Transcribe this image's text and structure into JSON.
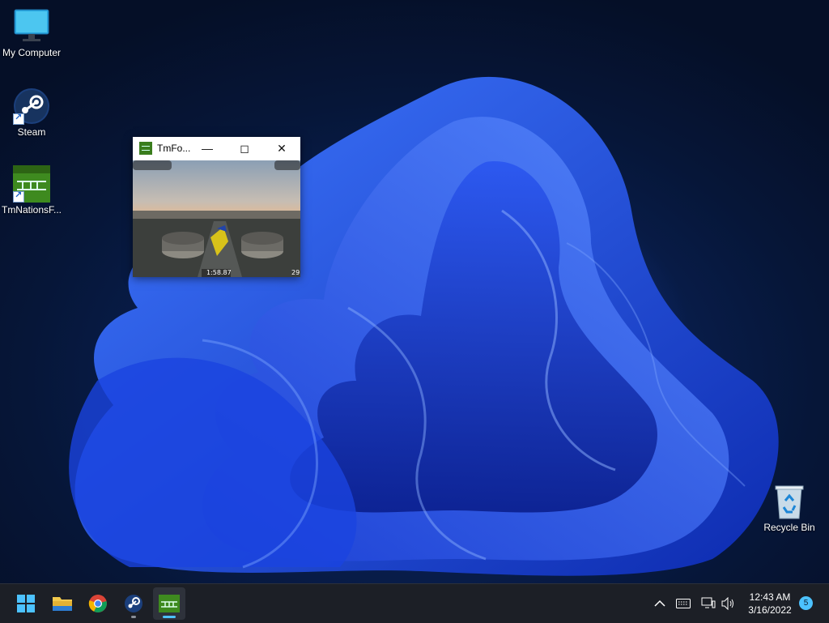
{
  "desktop": {
    "icons": [
      {
        "label": "My Computer"
      },
      {
        "label": "Steam"
      },
      {
        "label": "TmNationsF..."
      },
      {
        "label": "Recycle Bin"
      }
    ]
  },
  "window": {
    "title": "TmFo...",
    "game_hud": {
      "timer": "1:58.87",
      "speed": "29"
    }
  },
  "taskbar": {
    "apps": [
      {
        "name": "start-button",
        "icon": "windows-logo-icon"
      },
      {
        "name": "file-explorer",
        "icon": "folder-icon"
      },
      {
        "name": "chrome",
        "icon": "chrome-icon"
      },
      {
        "name": "steam",
        "icon": "steam-icon"
      },
      {
        "name": "tmnations",
        "icon": "tmnations-icon",
        "active": true
      }
    ],
    "tray": {
      "time": "12:43 AM",
      "date": "3/16/2022",
      "notification_count": "5"
    }
  },
  "colors": {
    "accent": "#4cc2ff",
    "taskbar": "#1c1f26",
    "wallpaper_blue": "#1f4fe0"
  }
}
